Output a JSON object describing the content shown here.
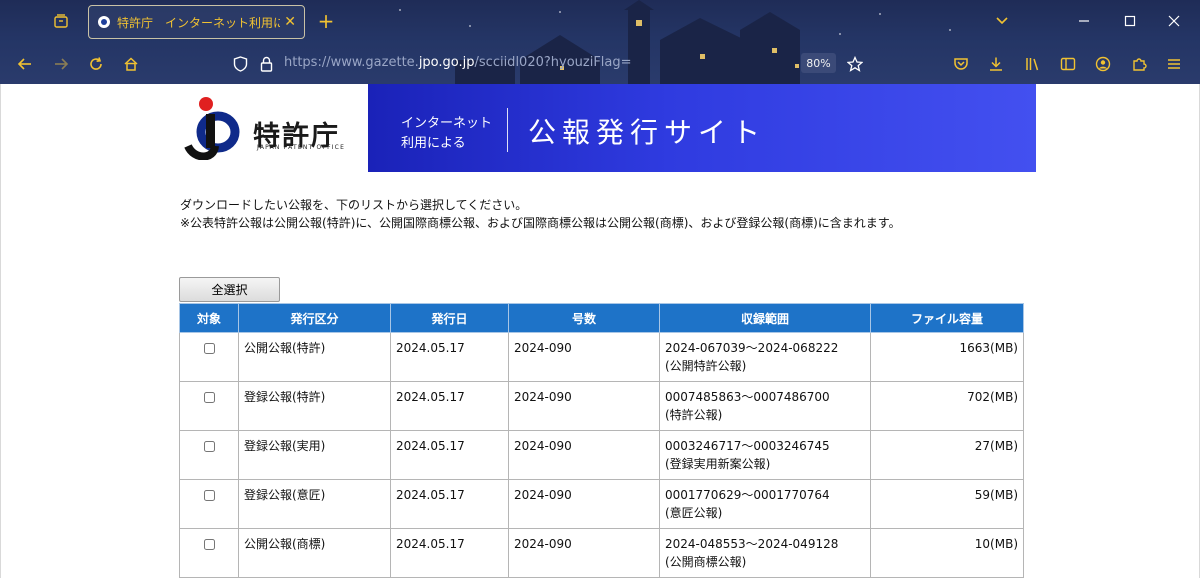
{
  "browser": {
    "tab_title": "特許庁　インターネット利用による公報発行サイト",
    "url_prefix": "https://www.gazette.",
    "url_domain": "jpo.go.jp",
    "url_path": "/scciidl020?hyouziFlag=",
    "zoom": "80%",
    "accent_color": "#f1c232"
  },
  "banner": {
    "agency_name": "特許庁",
    "agency_name_en": "JAPAN PATENT OFFICE",
    "subtitle_line1": "インターネット",
    "subtitle_line2": "利用による",
    "site_title": "公報発行サイト"
  },
  "instructions": {
    "line1": "ダウンロードしたい公報を、下のリストから選択してください。",
    "line2": "※公表特許公報は公開公報(特許)に、公開国際商標公報、および国際商標公報は公開公報(商標)、および登録公報(商標)に含まれます。"
  },
  "select_all_label": "全選択",
  "table": {
    "headers": [
      "対象",
      "発行区分",
      "発行日",
      "号数",
      "収録範囲",
      "ファイル容量"
    ],
    "rows": [
      {
        "category": "公開公報(特許)",
        "date": "2024.05.17",
        "issue": "2024-090",
        "range": "2024-067039～2024-068222",
        "range_note": "(公開特許公報)",
        "size": "1663(MB)"
      },
      {
        "category": "登録公報(特許)",
        "date": "2024.05.17",
        "issue": "2024-090",
        "range": "0007485863～0007486700",
        "range_note": "(特許公報)",
        "size": "702(MB)"
      },
      {
        "category": "登録公報(実用)",
        "date": "2024.05.17",
        "issue": "2024-090",
        "range": "0003246717～0003246745",
        "range_note": "(登録実用新案公報)",
        "size": "27(MB)"
      },
      {
        "category": "登録公報(意匠)",
        "date": "2024.05.17",
        "issue": "2024-090",
        "range": "0001770629～0001770764",
        "range_note": "(意匠公報)",
        "size": "59(MB)"
      },
      {
        "category": "公開公報(商標)",
        "date": "2024.05.17",
        "issue": "2024-090",
        "range": "2024-048553～2024-049128",
        "range_note": "(公開商標公報)",
        "size": "10(MB)"
      }
    ]
  }
}
